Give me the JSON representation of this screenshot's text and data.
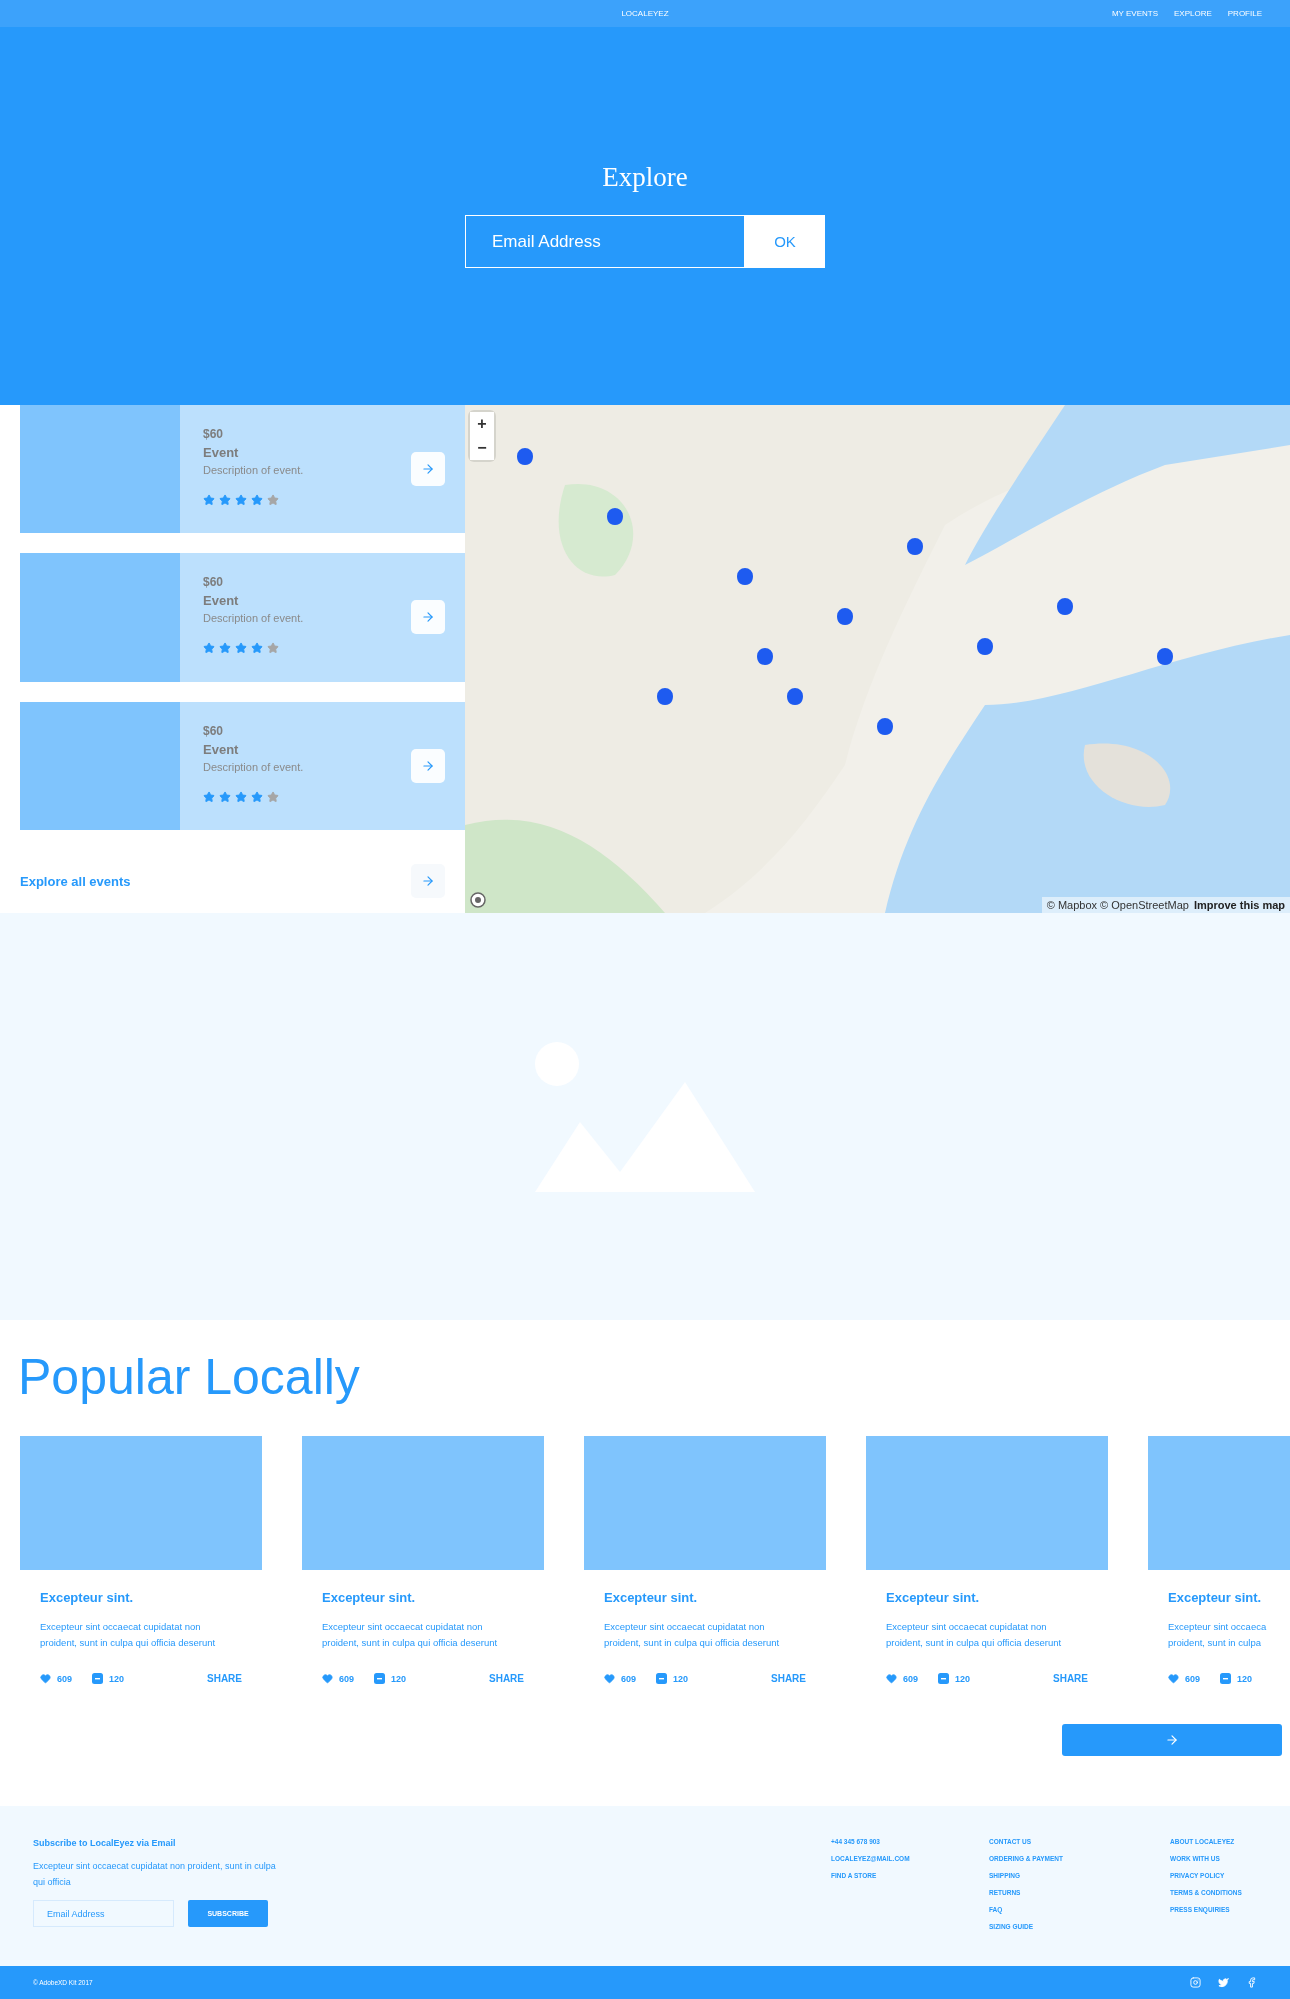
{
  "nav": {
    "brand": "LOCALEYEZ",
    "links": [
      "MY EVENTS",
      "EXPLORE",
      "PROFILE"
    ]
  },
  "hero": {
    "title": "Explore",
    "placeholder": "Email Address",
    "button": "OK"
  },
  "events": [
    {
      "price": "$60",
      "name": "Event",
      "description": "Description of event.",
      "stars": 4
    },
    {
      "price": "$60",
      "name": "Event",
      "description": "Description of event.",
      "stars": 4
    },
    {
      "price": "$60",
      "name": "Event",
      "description": "Description of event.",
      "stars": 4
    }
  ],
  "explore_link": "Explore all events",
  "map": {
    "zoom_in": "+",
    "zoom_out": "−",
    "attribution": "© Mapbox © OpenStreetMap",
    "improve_link": "Improve this map"
  },
  "popular": {
    "title": "Popular Locally",
    "cards": [
      {
        "title": "Excepteur sint.",
        "lines": [
          "Excepteur sint occaecat cupidatat non",
          "proident, sunt in culpa qui officia deserunt"
        ],
        "likes": "609",
        "comments": "120",
        "share": "SHARE"
      },
      {
        "title": "Excepteur sint.",
        "lines": [
          "Excepteur sint occaecat cupidatat non",
          "proident, sunt in culpa qui officia deserunt"
        ],
        "likes": "609",
        "comments": "120",
        "share": "SHARE"
      },
      {
        "title": "Excepteur sint.",
        "lines": [
          "Excepteur sint occaecat cupidatat non",
          "proident, sunt in culpa qui officia deserunt"
        ],
        "likes": "609",
        "comments": "120",
        "share": "SHARE"
      },
      {
        "title": "Excepteur sint.",
        "lines": [
          "Excepteur sint occaecat cupidatat non",
          "proident, sunt in culpa qui officia deserunt"
        ],
        "likes": "609",
        "comments": "120",
        "share": "SHARE"
      },
      {
        "title": "Excepteur sint.",
        "lines": [
          "Excepteur sint occaeca",
          "proident, sunt in culpa"
        ],
        "likes": "609",
        "comments": "120"
      }
    ]
  },
  "footer": {
    "subscribe_title": "Subscribe to LocalEyez via Email",
    "subscribe_text": "Excepteur sint occaecat cupidatat non proident, sunt in culpa qui officia",
    "placeholder": "Email Address",
    "button": "SUBSCRIBE",
    "columns": [
      [
        "+44 345 678 903",
        "LOCALEYEZ@MAIL.COM",
        "FIND A STORE"
      ],
      [
        "CONTACT US",
        "ORDERING & PAYMENT",
        "SHIPPING",
        "RETURNS",
        "FAQ",
        "SIZING GUIDE"
      ],
      [
        "ABOUT LOCALEYEZ",
        "WORK WITH US",
        "PRIVACY POLICY",
        "TERMS & CONDITIONS",
        "PRESS ENQUIRIES"
      ]
    ],
    "copyright": "© AdobeXD Kit 2017"
  }
}
